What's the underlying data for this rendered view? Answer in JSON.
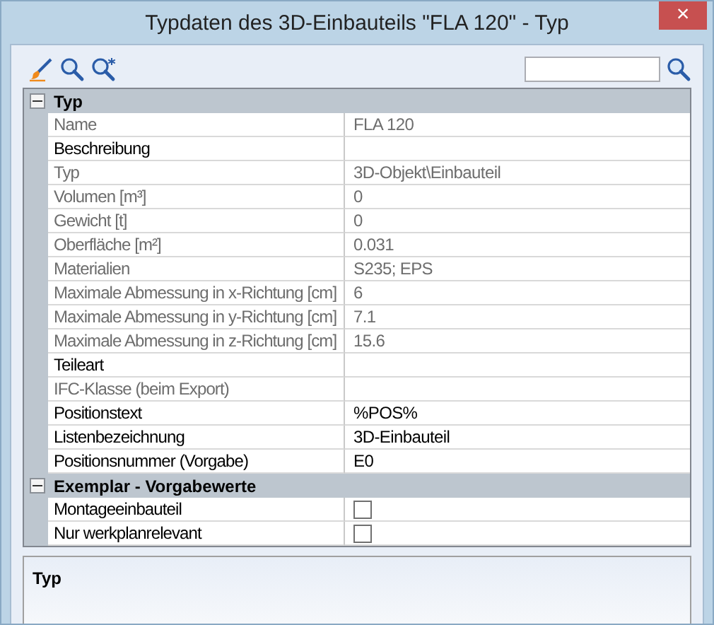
{
  "window": {
    "title": "Typdaten des 3D-Einbauteils \"FLA 120\" - Typ",
    "close": "×"
  },
  "categories": [
    {
      "title": "Typ",
      "expanded": true,
      "rows": [
        {
          "kind": "text",
          "label": "Name",
          "value": "FLA 120",
          "disabled": true
        },
        {
          "kind": "text",
          "label": "Beschreibung",
          "disabled": false
        },
        {
          "kind": "text",
          "label": "Typ",
          "value": "3D-Objekt\\Einbauteil",
          "disabled": true
        },
        {
          "kind": "text",
          "label": "Volumen [m³]",
          "value": "0",
          "disabled": true
        },
        {
          "kind": "text",
          "label": "Gewicht [t]",
          "value": "0",
          "disabled": true
        },
        {
          "kind": "text",
          "label": "Oberfläche [m²]",
          "value": "0.031",
          "disabled": true
        },
        {
          "kind": "text",
          "label": "Materialien",
          "value": "S235; EPS",
          "disabled": true
        },
        {
          "kind": "text",
          "label": "Maximale Abmessung in x-Richtung [cm]",
          "value": "6",
          "disabled": true
        },
        {
          "kind": "text",
          "label": "Maximale Abmessung in y-Richtung [cm]",
          "value": "7.1",
          "disabled": true
        },
        {
          "kind": "text",
          "label": "Maximale Abmessung in z-Richtung [cm]",
          "value": "15.6",
          "disabled": true
        },
        {
          "kind": "text",
          "label": "Teileart",
          "disabled": false
        },
        {
          "kind": "text",
          "label": "IFC-Klasse (beim Export)",
          "disabled": true
        },
        {
          "kind": "text",
          "label": "Positionstext",
          "value": "%POS%",
          "disabled": false
        },
        {
          "kind": "text",
          "label": "Listenbezeichnung",
          "value": "3D-Einbauteil",
          "disabled": false
        },
        {
          "kind": "text",
          "label": "Positionsnummer (Vorgabe)",
          "value": "E0",
          "disabled": false
        }
      ]
    },
    {
      "title": "Exemplar - Vorgabewerte",
      "expanded": true,
      "rows": [
        {
          "kind": "checkbox",
          "label": "Montageeinbauteil",
          "checked": false,
          "disabled": false
        },
        {
          "kind": "checkbox",
          "label": "Nur werkplanrelevant",
          "checked": false,
          "disabled": false
        }
      ]
    }
  ],
  "description": {
    "title": "Typ"
  }
}
